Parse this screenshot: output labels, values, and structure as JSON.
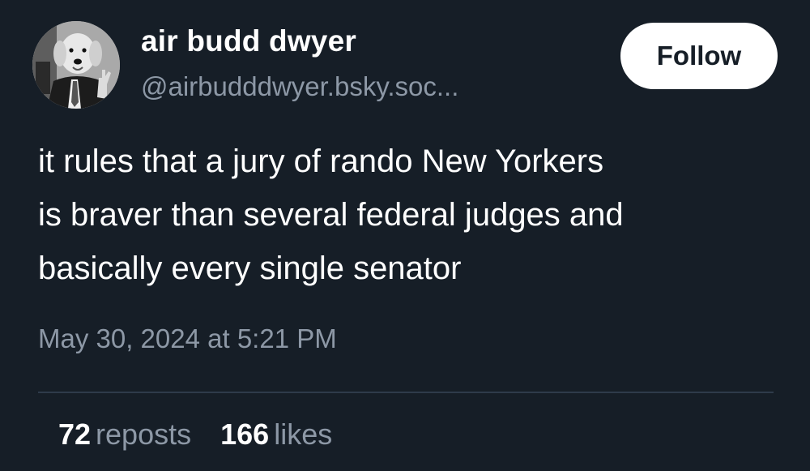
{
  "author": {
    "display_name": "air budd dwyer",
    "handle": "@airbudddwyer.bsky.soc...",
    "avatar": "dog-in-suit-avatar"
  },
  "follow_button": {
    "label": "Follow"
  },
  "post": {
    "lines": [
      "it rules that a jury of rando New Yorkers",
      "is braver than several federal judges and",
      "basically every single senator"
    ],
    "timestamp": "May 30, 2024 at 5:21 PM"
  },
  "stats": {
    "reposts": {
      "count": "72",
      "label": "reposts"
    },
    "likes": {
      "count": "166",
      "label": "likes"
    }
  },
  "colors": {
    "background": "#161e27",
    "text": "#ffffff",
    "muted": "#8d98a6",
    "divider": "#2e3b4a",
    "button_bg": "#ffffff"
  }
}
